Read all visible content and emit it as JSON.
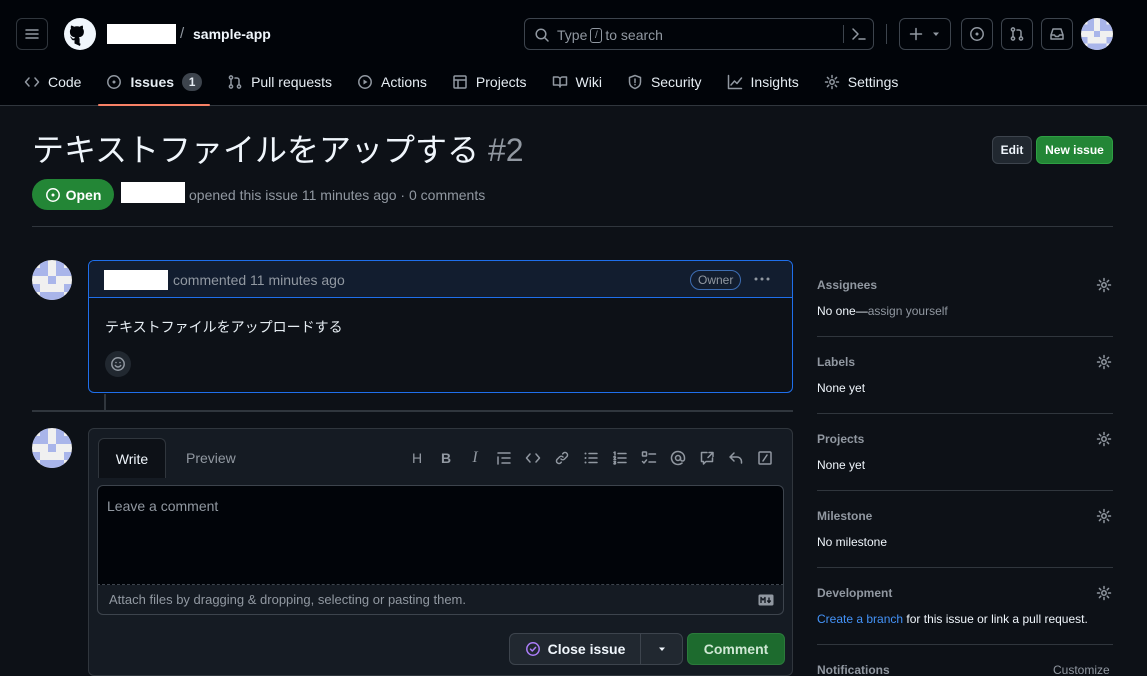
{
  "repo": {
    "name": "sample-app",
    "separator": "/"
  },
  "search": {
    "prefix": "Type",
    "key": "/",
    "suffix": "to search"
  },
  "tabs": [
    {
      "label": "Code",
      "icon": "code-icon"
    },
    {
      "label": "Issues",
      "icon": "issue-opened-icon",
      "count": "1",
      "selected": true
    },
    {
      "label": "Pull requests",
      "icon": "git-pull-request-icon"
    },
    {
      "label": "Actions",
      "icon": "play-icon"
    },
    {
      "label": "Projects",
      "icon": "table-icon"
    },
    {
      "label": "Wiki",
      "icon": "book-icon"
    },
    {
      "label": "Security",
      "icon": "shield-icon"
    },
    {
      "label": "Insights",
      "icon": "graph-icon"
    },
    {
      "label": "Settings",
      "icon": "gear-icon"
    }
  ],
  "issue": {
    "title": "テキストファイルをアップする",
    "number": "#2",
    "state": "Open",
    "meta": "opened this issue 11 minutes ago · 0 comments",
    "edit_label": "Edit",
    "new_issue_label": "New issue"
  },
  "comment": {
    "meta": "commented 11 minutes ago",
    "badge": "Owner",
    "body": "テキストファイルをアップロードする"
  },
  "editor": {
    "tab_write": "Write",
    "tab_preview": "Preview",
    "placeholder": "Leave a comment",
    "attach_hint": "Attach files by dragging & dropping, selecting or pasting them.",
    "close_label": "Close issue",
    "comment_label": "Comment",
    "toolbar_heading": "H",
    "toolbar_bold": "B",
    "toolbar_italic": "I"
  },
  "sidebar": {
    "assignees": {
      "title": "Assignees",
      "value": "No one—",
      "action": "assign yourself"
    },
    "labels": {
      "title": "Labels",
      "value": "None yet"
    },
    "projects": {
      "title": "Projects",
      "value": "None yet"
    },
    "milestone": {
      "title": "Milestone",
      "value": "No milestone"
    },
    "development": {
      "title": "Development",
      "link": "Create a branch",
      "rest": " for this issue or link a pull request."
    },
    "notifications": {
      "title": "Notifications",
      "action": "Customize"
    }
  },
  "colors": {
    "background": "#0d1117",
    "header": "#010409",
    "open_green": "#238636",
    "accent_blue": "#1f6feb",
    "tab_underline": "#f78166",
    "link": "#4493f8"
  }
}
